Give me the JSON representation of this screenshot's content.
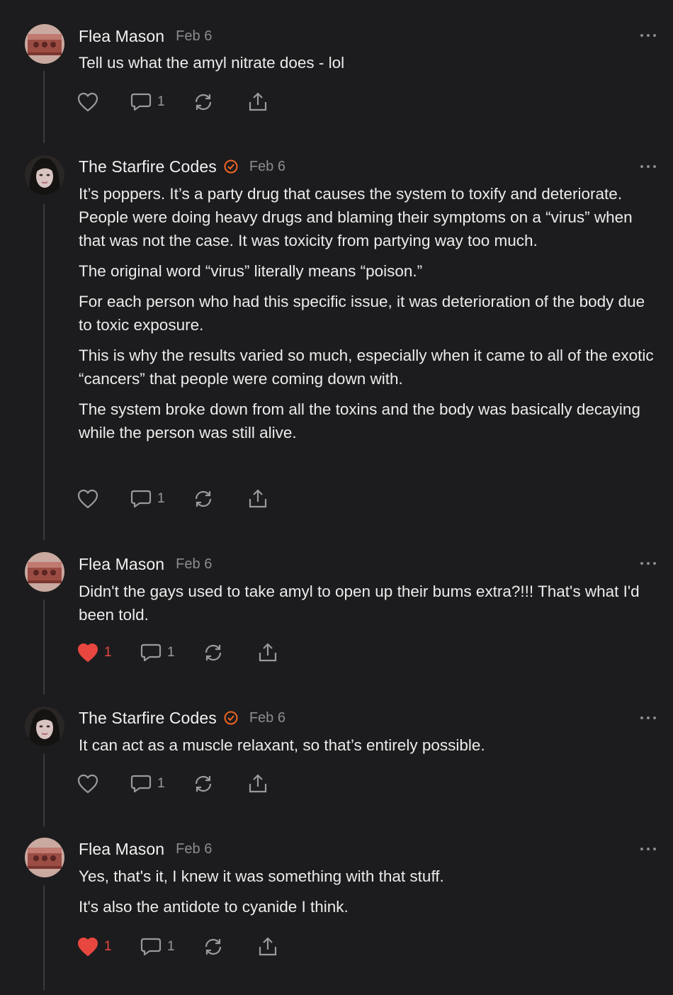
{
  "comments": [
    {
      "author": "Flea Mason",
      "verified": false,
      "avatar_icon": "brick-avatar",
      "date": "Feb 6",
      "paragraphs": [
        "Tell us what the amyl nitrate does - lol"
      ],
      "liked": false,
      "like_count": "",
      "reply_count": "1"
    },
    {
      "author": "The Starfire Codes",
      "verified": true,
      "avatar_icon": "woman-portrait-avatar",
      "date": "Feb 6",
      "paragraphs": [
        "It’s poppers. It’s a party drug that causes the system to toxify and deteriorate. People were doing heavy drugs and blaming their symptoms on a “virus” when that was not the case. It was toxicity from partying way too much.",
        "The original word “virus” literally means “poison.”",
        "For each person who had this specific issue, it was deterioration of the body due to toxic exposure.",
        "This is why the results varied so much, especially when it came to all of the exotic “cancers” that people were coming down with.",
        "The system broke down from all the toxins and the body was basically decaying while the person was still alive."
      ],
      "liked": false,
      "like_count": "",
      "reply_count": "1"
    },
    {
      "author": "Flea Mason",
      "verified": false,
      "avatar_icon": "brick-avatar",
      "date": "Feb 6",
      "paragraphs": [
        "Didn't the gays used to take amyl to open up their bums extra?!!! That's what I'd been told."
      ],
      "liked": true,
      "like_count": "1",
      "reply_count": "1"
    },
    {
      "author": "The Starfire Codes",
      "verified": true,
      "avatar_icon": "woman-portrait-avatar",
      "date": "Feb 6",
      "paragraphs": [
        "It can act as a muscle relaxant, so that’s entirely possible."
      ],
      "liked": false,
      "like_count": "",
      "reply_count": "1"
    },
    {
      "author": "Flea Mason",
      "verified": false,
      "avatar_icon": "brick-avatar",
      "date": "Feb 6",
      "paragraphs": [
        "Yes, that's it, I knew it was something with that stuff.",
        "It's also the antidote to cyanide I think."
      ],
      "liked": true,
      "like_count": "1",
      "reply_count": "1"
    }
  ],
  "colors": {
    "background": "#1c1c1e",
    "liked_heart": "#e8473f",
    "verified_badge": "#f26522",
    "muted": "#8c8c90"
  }
}
